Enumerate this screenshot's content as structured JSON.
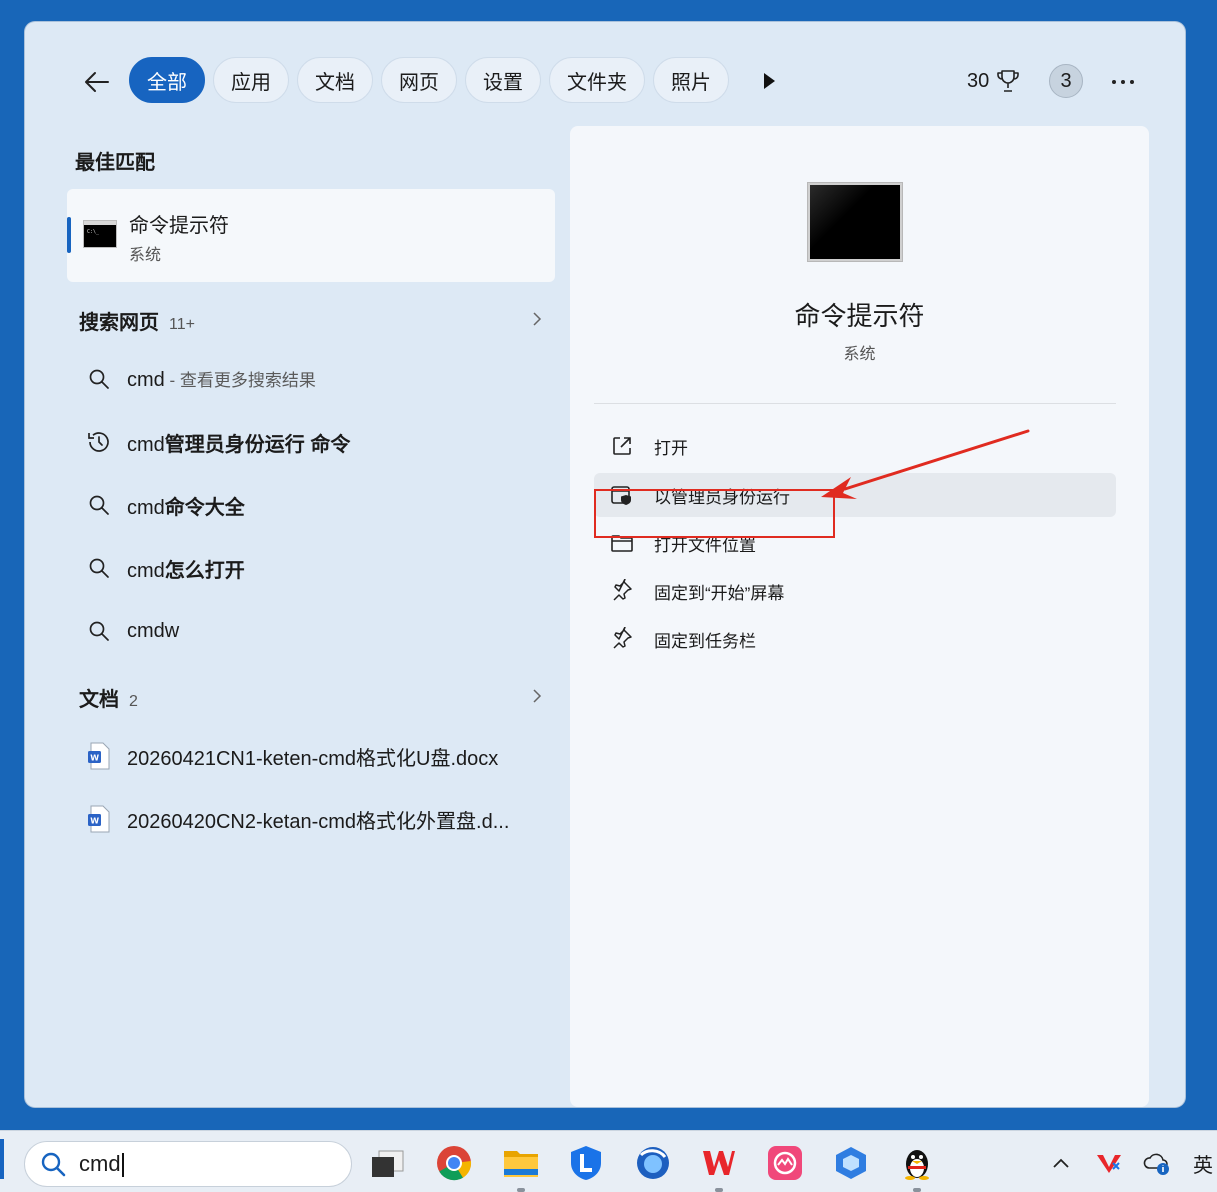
{
  "topbar": {
    "tabs": [
      "全部",
      "应用",
      "文档",
      "网页",
      "设置",
      "文件夹",
      "照片"
    ],
    "points": "30",
    "badge": "3"
  },
  "best_match": {
    "heading": "最佳匹配",
    "title": "命令提示符",
    "subtitle": "系统"
  },
  "web": {
    "heading": "搜索网页",
    "count": "11+",
    "items": [
      {
        "prefix": "cmd",
        "suffix": " - 查看更多搜索结果",
        "icon": "search-icon"
      },
      {
        "prefix": "cmd",
        "bold": "管理员身份运行 命令",
        "icon": "history-icon"
      },
      {
        "prefix": "cmd",
        "bold": "命令大全",
        "icon": "search-icon"
      },
      {
        "prefix": "cmd",
        "bold": "怎么打开",
        "icon": "search-icon"
      },
      {
        "prefix": "cmdw",
        "icon": "search-icon"
      }
    ]
  },
  "docs": {
    "heading": "文档",
    "count": "2",
    "items": [
      "20260421CN1-keten-cmd格式化U盘.docx",
      "20260420CN2-ketan-cmd格式化外置盘.d..."
    ]
  },
  "detail": {
    "title": "命令提示符",
    "subtitle": "系统",
    "actions": [
      "打开",
      "以管理员身份运行",
      "打开文件位置",
      "固定到“开始”屏幕",
      "固定到任务栏"
    ]
  },
  "taskbar": {
    "search_value": "cmd",
    "ime": "英"
  },
  "colors": {
    "accent": "#1764c0",
    "highlight": "#e02b20"
  }
}
